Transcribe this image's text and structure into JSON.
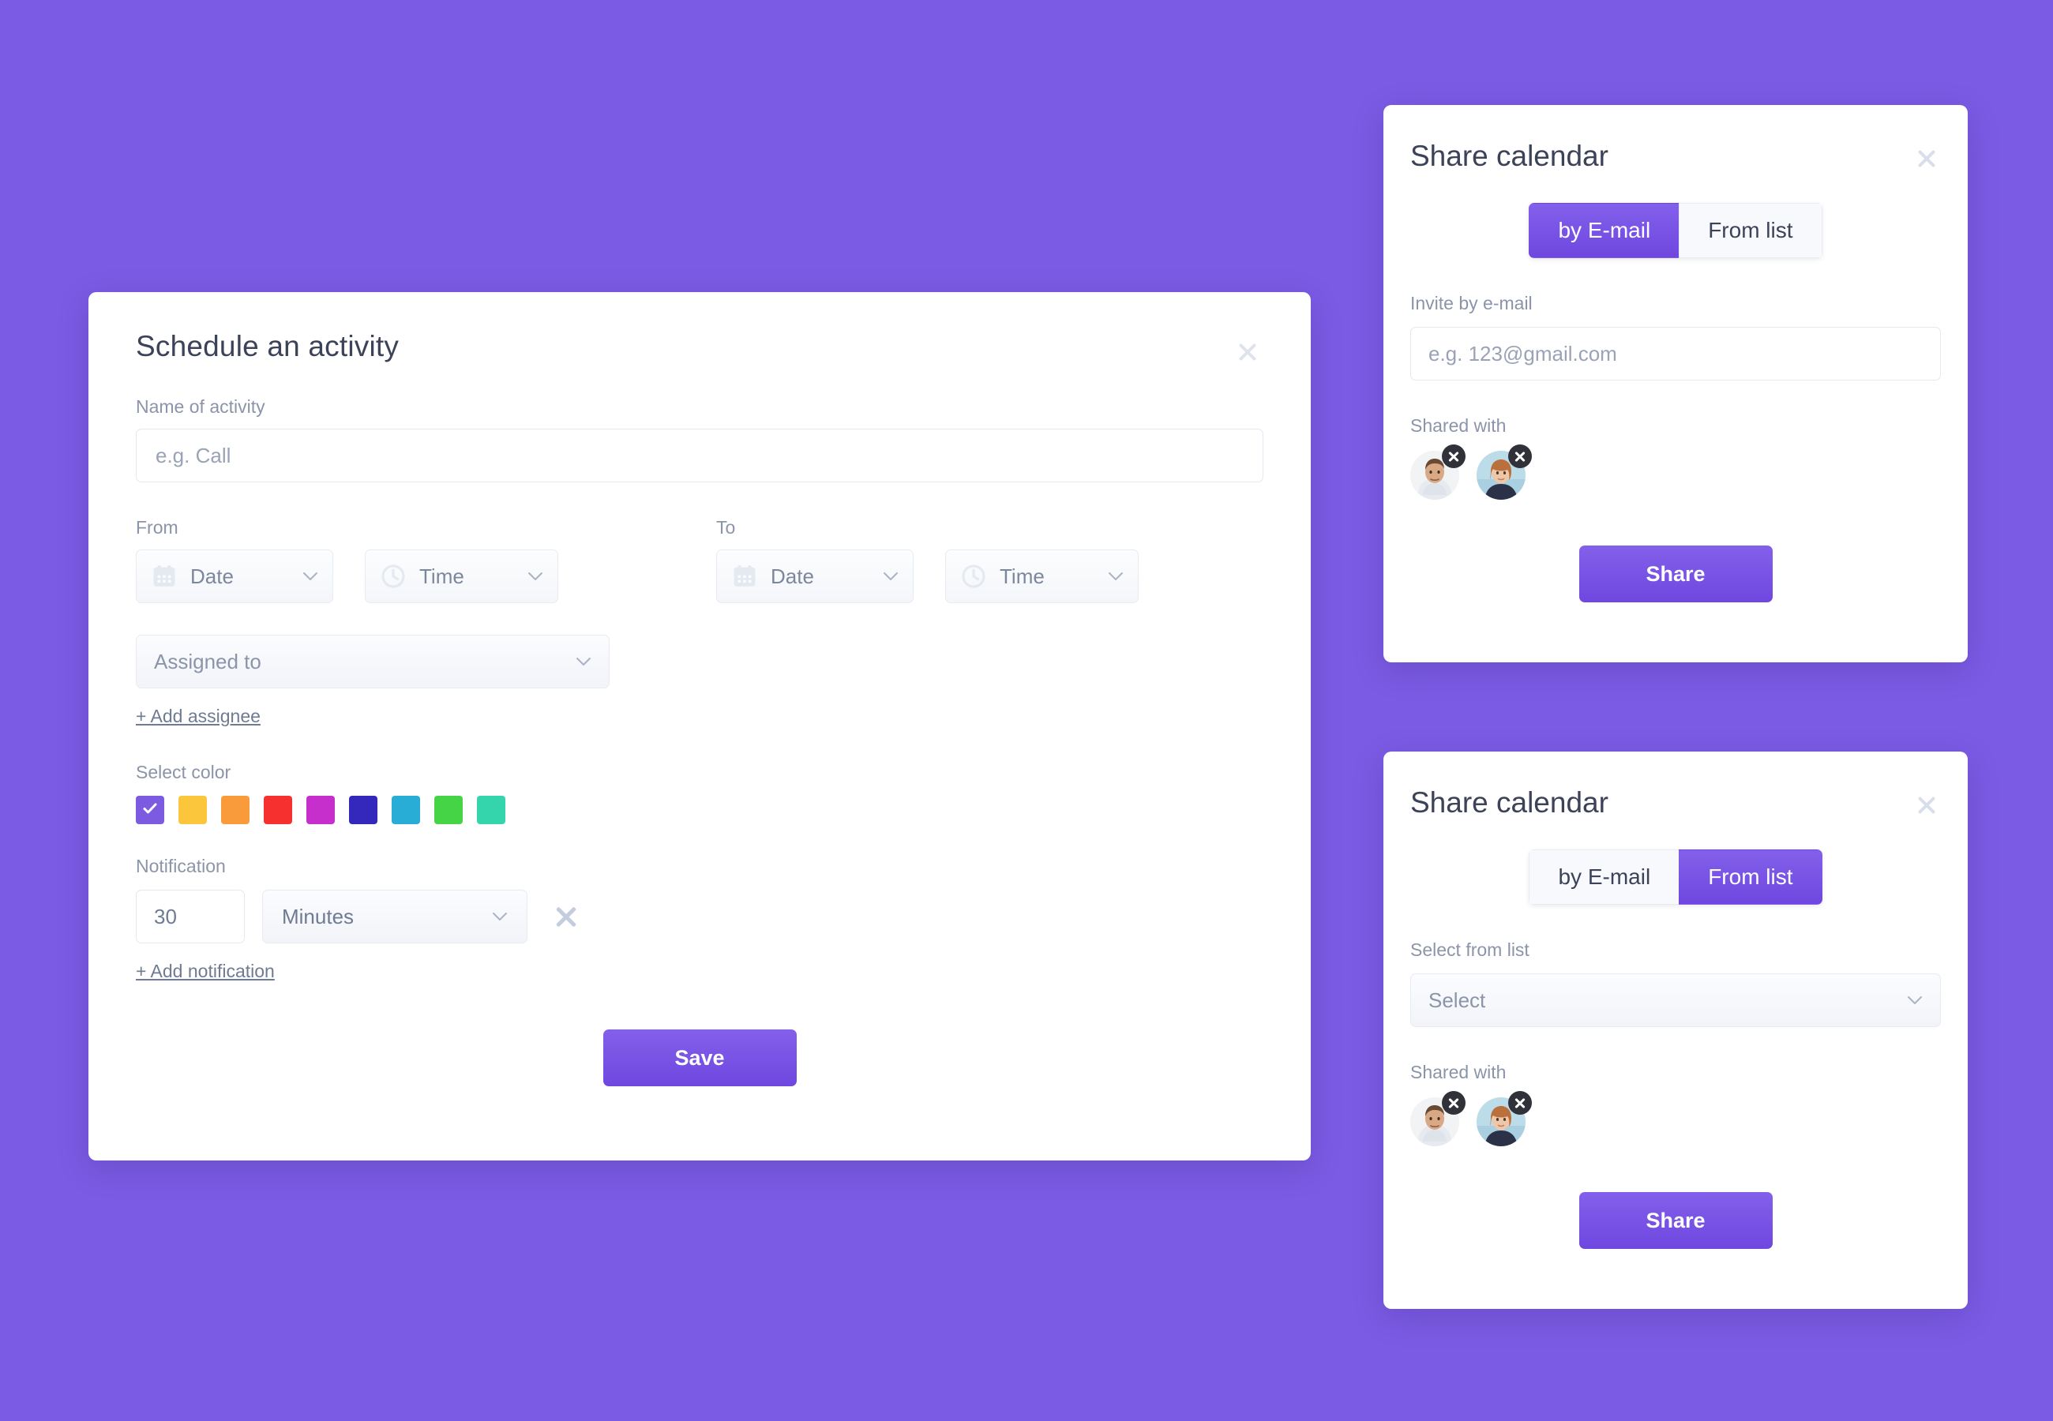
{
  "background_color": "#7B5BE4",
  "accent_color": "#6F47E0",
  "activity_modal": {
    "title": "Schedule an activity",
    "close_icon": "close-icon",
    "name_label": "Name of activity",
    "name_placeholder": "e.g. Call",
    "name_value": "",
    "from_label": "From",
    "to_label": "To",
    "from_date_placeholder": "Date",
    "from_time_placeholder": "Time",
    "to_date_placeholder": "Date",
    "to_time_placeholder": "Time",
    "date_icon": "calendar-icon",
    "time_icon": "clock-icon",
    "caret_icon": "chevron-down-icon",
    "assigned_placeholder": "Assigned to",
    "add_assignee_label": "+ Add assignee",
    "select_color_label": "Select color",
    "colors": [
      {
        "name": "purple",
        "hex": "#7D5BE0",
        "selected": true
      },
      {
        "name": "yellow",
        "hex": "#FBC53C",
        "selected": false
      },
      {
        "name": "orange",
        "hex": "#F99B3A",
        "selected": false
      },
      {
        "name": "red",
        "hex": "#F62F2F",
        "selected": false
      },
      {
        "name": "magenta",
        "hex": "#C62FCB",
        "selected": false
      },
      {
        "name": "indigo",
        "hex": "#3327BC",
        "selected": false
      },
      {
        "name": "cyan",
        "hex": "#28AED6",
        "selected": false
      },
      {
        "name": "green",
        "hex": "#45D445",
        "selected": false
      },
      {
        "name": "teal",
        "hex": "#34D5AD",
        "selected": false
      }
    ],
    "selected_color_check_icon": "check-icon",
    "notification_label": "Notification",
    "notification_amount": "30",
    "notification_unit": "Minutes",
    "notification_delete_icon": "close-icon",
    "add_notification_label": "+ Add notification",
    "save_label": "Save"
  },
  "share_panel_email": {
    "title": "Share calendar",
    "close_icon": "close-icon",
    "tabs": [
      {
        "label": "by E-mail",
        "active": true
      },
      {
        "label": "From list",
        "active": false
      }
    ],
    "invite_label": "Invite by e-mail",
    "invite_placeholder": "e.g. 123@gmail.com",
    "invite_value": "",
    "shared_with_label": "Shared with",
    "shared_with": [
      {
        "name": "avatar-male",
        "remove_icon": "close-icon"
      },
      {
        "name": "avatar-female",
        "remove_icon": "close-icon"
      }
    ],
    "share_label": "Share"
  },
  "share_panel_list": {
    "title": "Share calendar",
    "close_icon": "close-icon",
    "tabs": [
      {
        "label": "by E-mail",
        "active": false
      },
      {
        "label": "From list",
        "active": true
      }
    ],
    "select_label": "Select from list",
    "select_placeholder": "Select",
    "caret_icon": "chevron-down-icon",
    "shared_with_label": "Shared with",
    "shared_with": [
      {
        "name": "avatar-male",
        "remove_icon": "close-icon"
      },
      {
        "name": "avatar-female",
        "remove_icon": "close-icon"
      }
    ],
    "share_label": "Share"
  }
}
